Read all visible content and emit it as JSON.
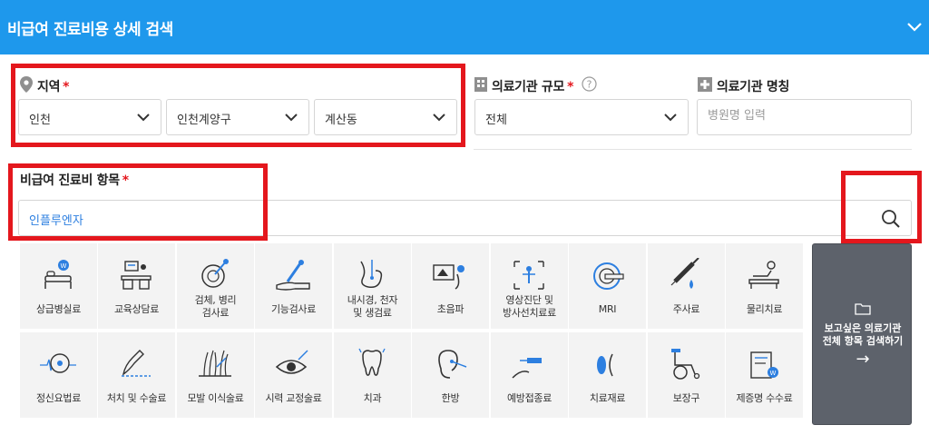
{
  "header": {
    "title": "비급여 진료비용 상세 검색"
  },
  "region": {
    "label": "지역",
    "required_mark": "*",
    "city": "인천",
    "district": "인천계양구",
    "dong": "계산동"
  },
  "hospital_scale": {
    "label": "의료기관 규모",
    "required_mark": "*",
    "value": "전체"
  },
  "hospital_name": {
    "label": "의료기관 명칭",
    "placeholder": "병원명 입력"
  },
  "item": {
    "label": "비급여 진료비 항목",
    "required_mark": "*",
    "value": "인플루엔자"
  },
  "categories": [
    {
      "label": "상급병실료",
      "icon": "hospital-bed-icon"
    },
    {
      "label": "교육상담료",
      "icon": "counseling-desk-icon"
    },
    {
      "label": "검체, 병리\n검사료",
      "icon": "lab-dish-icon"
    },
    {
      "label": "기능검사료",
      "icon": "arm-test-icon"
    },
    {
      "label": "내시경, 천자\n및 생검료",
      "icon": "endoscope-icon"
    },
    {
      "label": "초음파",
      "icon": "ultrasound-icon"
    },
    {
      "label": "영상진단 및\n방사선치료료",
      "icon": "xray-icon"
    },
    {
      "label": "MRI",
      "icon": "mri-icon"
    },
    {
      "label": "주사료",
      "icon": "syringe-icon"
    },
    {
      "label": "물리치료",
      "icon": "physical-therapy-icon"
    },
    {
      "label": "정신요법료",
      "icon": "brain-wave-icon"
    },
    {
      "label": "처치 및 수술료",
      "icon": "scalpel-icon"
    },
    {
      "label": "모발 이식술료",
      "icon": "hair-transplant-icon"
    },
    {
      "label": "시력 교정술료",
      "icon": "eye-laser-icon"
    },
    {
      "label": "치과",
      "icon": "tooth-icon"
    },
    {
      "label": "한방",
      "icon": "acupuncture-ear-icon"
    },
    {
      "label": "예방접종료",
      "icon": "vaccination-icon"
    },
    {
      "label": "치료재료",
      "icon": "lens-material-icon"
    },
    {
      "label": "보장구",
      "icon": "wheelchair-icon"
    },
    {
      "label": "제증명 수수료",
      "icon": "certificate-icon"
    }
  ],
  "view_all": {
    "label": "보고싶은 의료기관\n전체 항목 검색하기",
    "arrow": "→",
    "icon": "folder-icon"
  },
  "colors": {
    "header": "#1e98ec",
    "accent_blue": "#2d7fe0",
    "highlight_red": "#e4171d",
    "panel": "#5d626b",
    "tile": "#f3f3f3"
  }
}
